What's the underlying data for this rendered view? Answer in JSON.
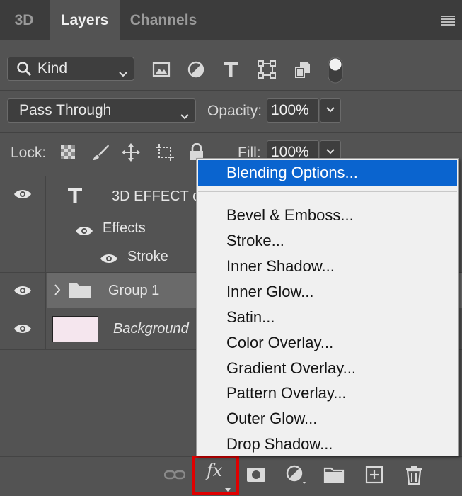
{
  "tabs": [
    {
      "label": "3D"
    },
    {
      "label": "Layers"
    },
    {
      "label": "Channels"
    }
  ],
  "filter": {
    "kind_label": "Kind",
    "icons": [
      "image-filter-icon",
      "adjustment-filter-icon",
      "type-filter-icon",
      "shape-filter-icon",
      "smart-object-filter-icon"
    ]
  },
  "blend": {
    "mode": "Pass Through",
    "opacity_label": "Opacity:",
    "opacity_value": "100%"
  },
  "lock": {
    "label": "Lock:",
    "fill_label": "Fill:",
    "fill_value": "100%"
  },
  "layers": {
    "text_layer": "3D EFFECT c",
    "effects_label": "Effects",
    "stroke_label": "Stroke",
    "group_label": "Group 1",
    "background_label": "Background"
  },
  "colors": {
    "background_thumb": "#f5e6ee",
    "highlight": "#0a64cf",
    "fx_outline": "#e00000"
  },
  "context_menu": {
    "items": [
      {
        "label": "Blending Options..."
      },
      {
        "label": "Bevel & Emboss..."
      },
      {
        "label": "Stroke..."
      },
      {
        "label": "Inner Shadow..."
      },
      {
        "label": "Inner Glow..."
      },
      {
        "label": "Satin..."
      },
      {
        "label": "Color Overlay..."
      },
      {
        "label": "Gradient Overlay..."
      },
      {
        "label": "Pattern Overlay..."
      },
      {
        "label": "Outer Glow..."
      },
      {
        "label": "Drop Shadow..."
      }
    ]
  },
  "bottom_bar": {
    "fx_label": "fx"
  }
}
